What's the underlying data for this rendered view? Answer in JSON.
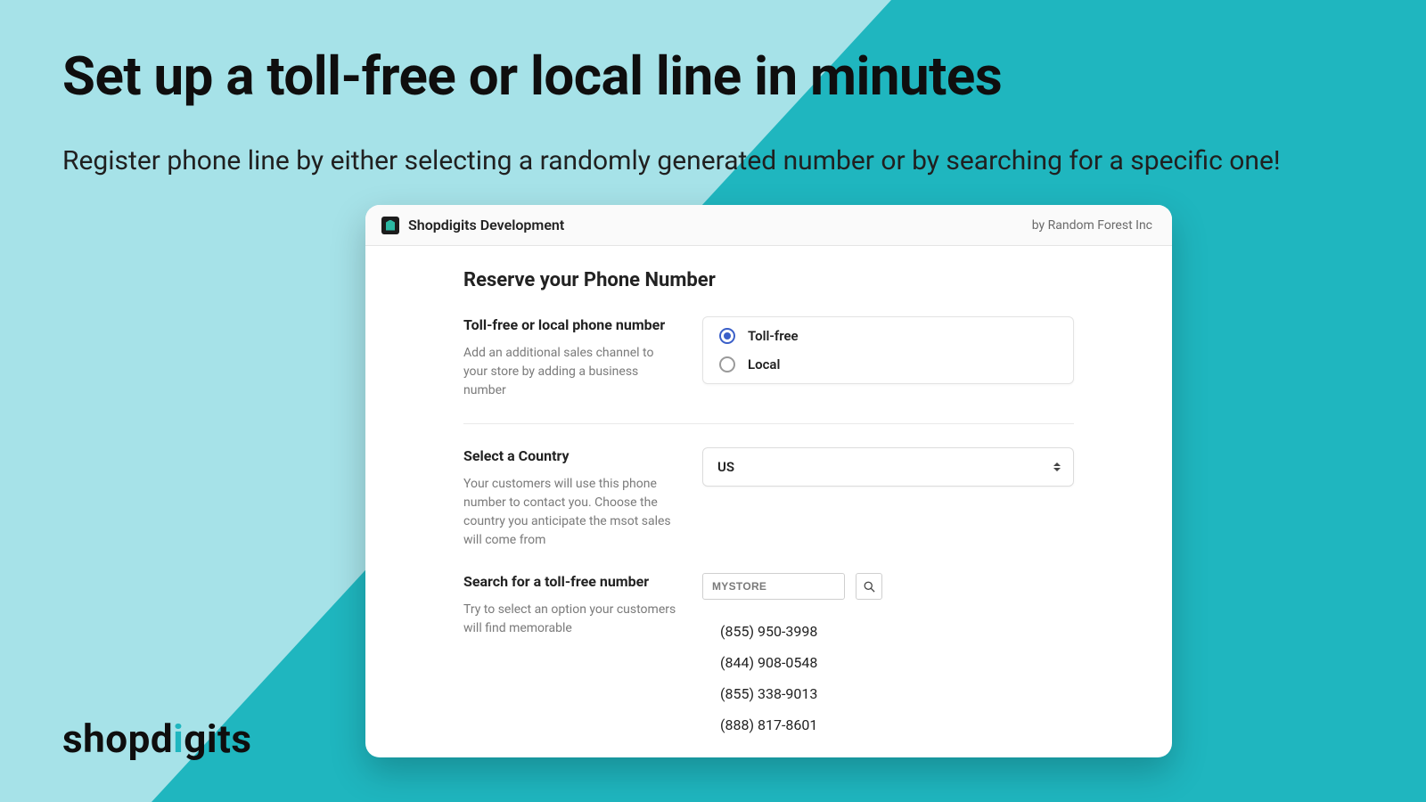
{
  "hero": {
    "title": "Set up a toll-free or local line in minutes",
    "subtitle": "Register phone line by either selecting a randomly generated number or by searching for a specific one!"
  },
  "brand": {
    "prefix": "shopd",
    "accent": "i",
    "suffix": "gits"
  },
  "app": {
    "name": "Shopdigits Development",
    "byline": "by Random Forest Inc"
  },
  "form": {
    "section_title": "Reserve your Phone Number",
    "number_type": {
      "label": "Toll-free or local phone number",
      "help": "Add an additional sales channel to your store by adding a business number",
      "options": {
        "tollfree": "Toll-free",
        "local": "Local"
      },
      "selected": "tollfree"
    },
    "country": {
      "label": "Select a Country",
      "help": "Your customers will use this phone number to contact you. Choose the country you anticipate the msot sales will come from",
      "value": "US"
    },
    "search": {
      "label": "Search for a toll-free number",
      "help": "Try to select an option your customers will find memorable",
      "input_value": "MYSTORE",
      "results": [
        "(855) 950-3998",
        "(844) 908-0548",
        "(855) 338-9013",
        "(888) 817-8601"
      ]
    }
  },
  "colors": {
    "bg_light": "#a6e2e8",
    "bg_dark": "#1fb6bf"
  }
}
